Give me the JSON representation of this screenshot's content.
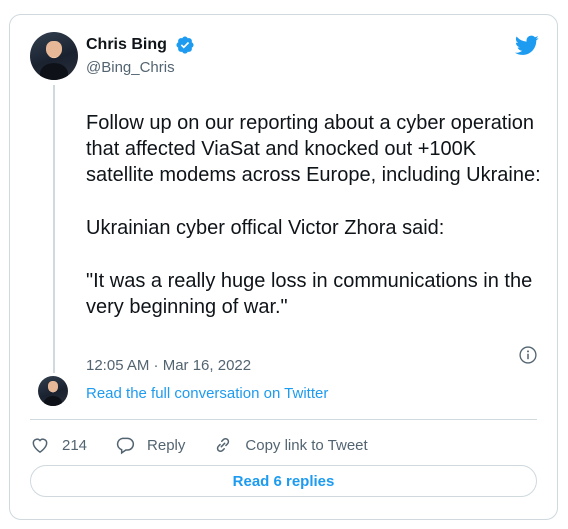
{
  "author": {
    "name": "Chris Bing",
    "handle": "@Bing_Chris"
  },
  "tweet": {
    "paragraphs": [
      "Follow up on our reporting about a cyber operation that affected ViaSat and knocked out +100K satellite modems across Europe, including Ukraine:",
      "Ukrainian cyber offical Victor Zhora said:",
      "\"It was a really huge loss in communications in the very beginning of war.\""
    ],
    "timestamp": "12:05 AM · Mar 16, 2022"
  },
  "conversation_link": "Read the full conversation on Twitter",
  "actions": {
    "likes": "214",
    "reply_label": "Reply",
    "copy_label": "Copy link to Tweet"
  },
  "replies_button": "Read 6 replies",
  "icons": {
    "brand": "twitter-bird-icon",
    "verified": "verified-badge-icon",
    "info": "info-icon",
    "like": "heart-icon",
    "reply": "reply-icon",
    "copy": "link-icon"
  },
  "colors": {
    "accent": "#1d9bf0",
    "muted": "#536471",
    "border": "#cfd9de"
  }
}
